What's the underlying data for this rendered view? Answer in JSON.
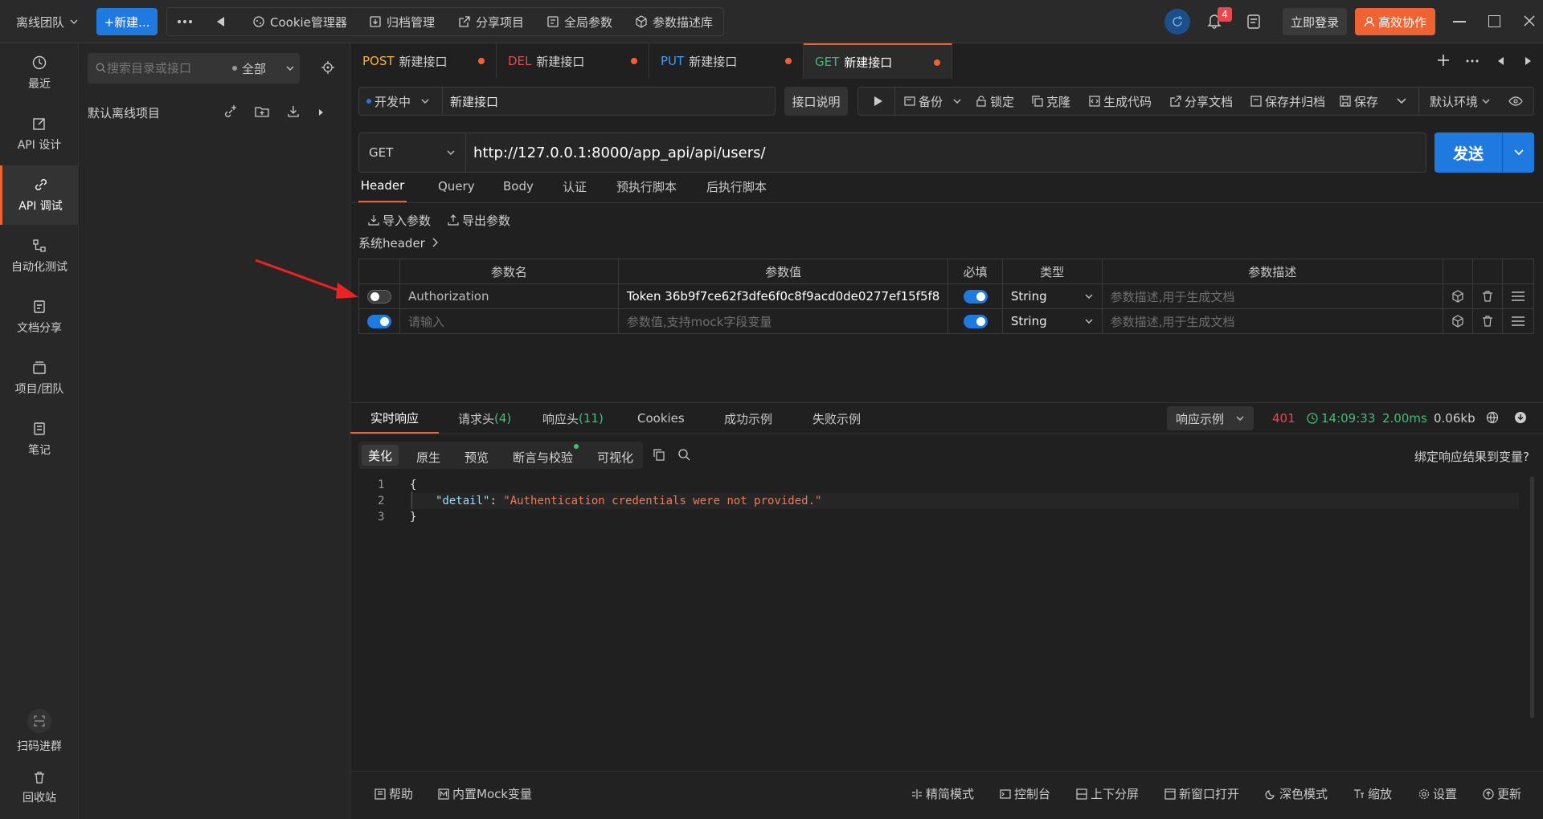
{
  "topbar": {
    "team": "离线团队",
    "new_button": "+新建...",
    "tools": [
      "Cookie管理器",
      "归档管理",
      "分享项目",
      "全局参数",
      "参数描述库"
    ],
    "notif_count": "4",
    "login": "立即登录",
    "collab": "高效协作"
  },
  "leftnav": {
    "items": [
      "最近",
      "API 设计",
      "API 调试",
      "自动化测试",
      "文档分享",
      "项目/团队",
      "笔记"
    ],
    "bottom": [
      "扫码进群",
      "回收站"
    ]
  },
  "sidebar": {
    "search_placeholder": "搜索目录或接口",
    "filter": "全部",
    "project": "默认离线项目"
  },
  "tabs": [
    {
      "method": "POST",
      "name": "新建接口",
      "color": "#f5b52b"
    },
    {
      "method": "DEL",
      "name": "新建接口",
      "color": "#e5484d"
    },
    {
      "method": "PUT",
      "name": "新建接口",
      "color": "#3b9cf7"
    },
    {
      "method": "GET",
      "name": "新建接口",
      "color": "#3fbf74"
    }
  ],
  "request": {
    "status": "开发中",
    "name": "新建接口",
    "desc_button": "接口说明",
    "actions": [
      "备份",
      "锁定",
      "克隆",
      "生成代码",
      "分享文档",
      "保存并归档",
      "保存"
    ],
    "env": "默认环境",
    "method": "GET",
    "url": "http://127.0.0.1:8000/app_api/api/users/",
    "send": "发送"
  },
  "subtabs": [
    "Header",
    "Query",
    "Body",
    "认证",
    "预执行脚本",
    "后执行脚本"
  ],
  "header": {
    "import": "导入参数",
    "export": "导出参数",
    "system": "系统header",
    "columns": [
      "参数名",
      "参数值",
      "必填",
      "类型",
      "参数描述"
    ],
    "rows": [
      {
        "name": "Authorization",
        "value": "Token 36b9f7ce62f3dfe6f0c8f9acd0de0277ef15f5f8",
        "type": "String",
        "desc_ph": "参数描述,用于生成文档",
        "enabled": false
      },
      {
        "name_ph": "请输入",
        "value_ph": "参数值,支持mock字段变量",
        "type": "String",
        "desc_ph": "参数描述,用于生成文档",
        "enabled": true
      }
    ]
  },
  "response": {
    "tabs": [
      "实时响应",
      "请求头",
      "(4)",
      "响应头",
      "(11)",
      "Cookies",
      "成功示例",
      "失败示例"
    ],
    "example": "响应示例",
    "status_code": "401",
    "time": "14:09:33",
    "duration": "2.00ms",
    "size": "0.06kb",
    "view_tabs": [
      "美化",
      "原生",
      "预览",
      "断言与校验",
      "可视化"
    ],
    "bind": "绑定响应结果到变量?",
    "lines": [
      "1",
      "2",
      "3"
    ],
    "code": [
      "{",
      "\"detail\"",
      ": ",
      "\"Authentication credentials were not provided.\"",
      "}"
    ]
  },
  "bottombar": [
    "帮助",
    "内置Mock变量",
    "精简模式",
    "控制台",
    "上下分屏",
    "新窗口打开",
    "深色模式",
    "缩放",
    "设置",
    "更新"
  ]
}
